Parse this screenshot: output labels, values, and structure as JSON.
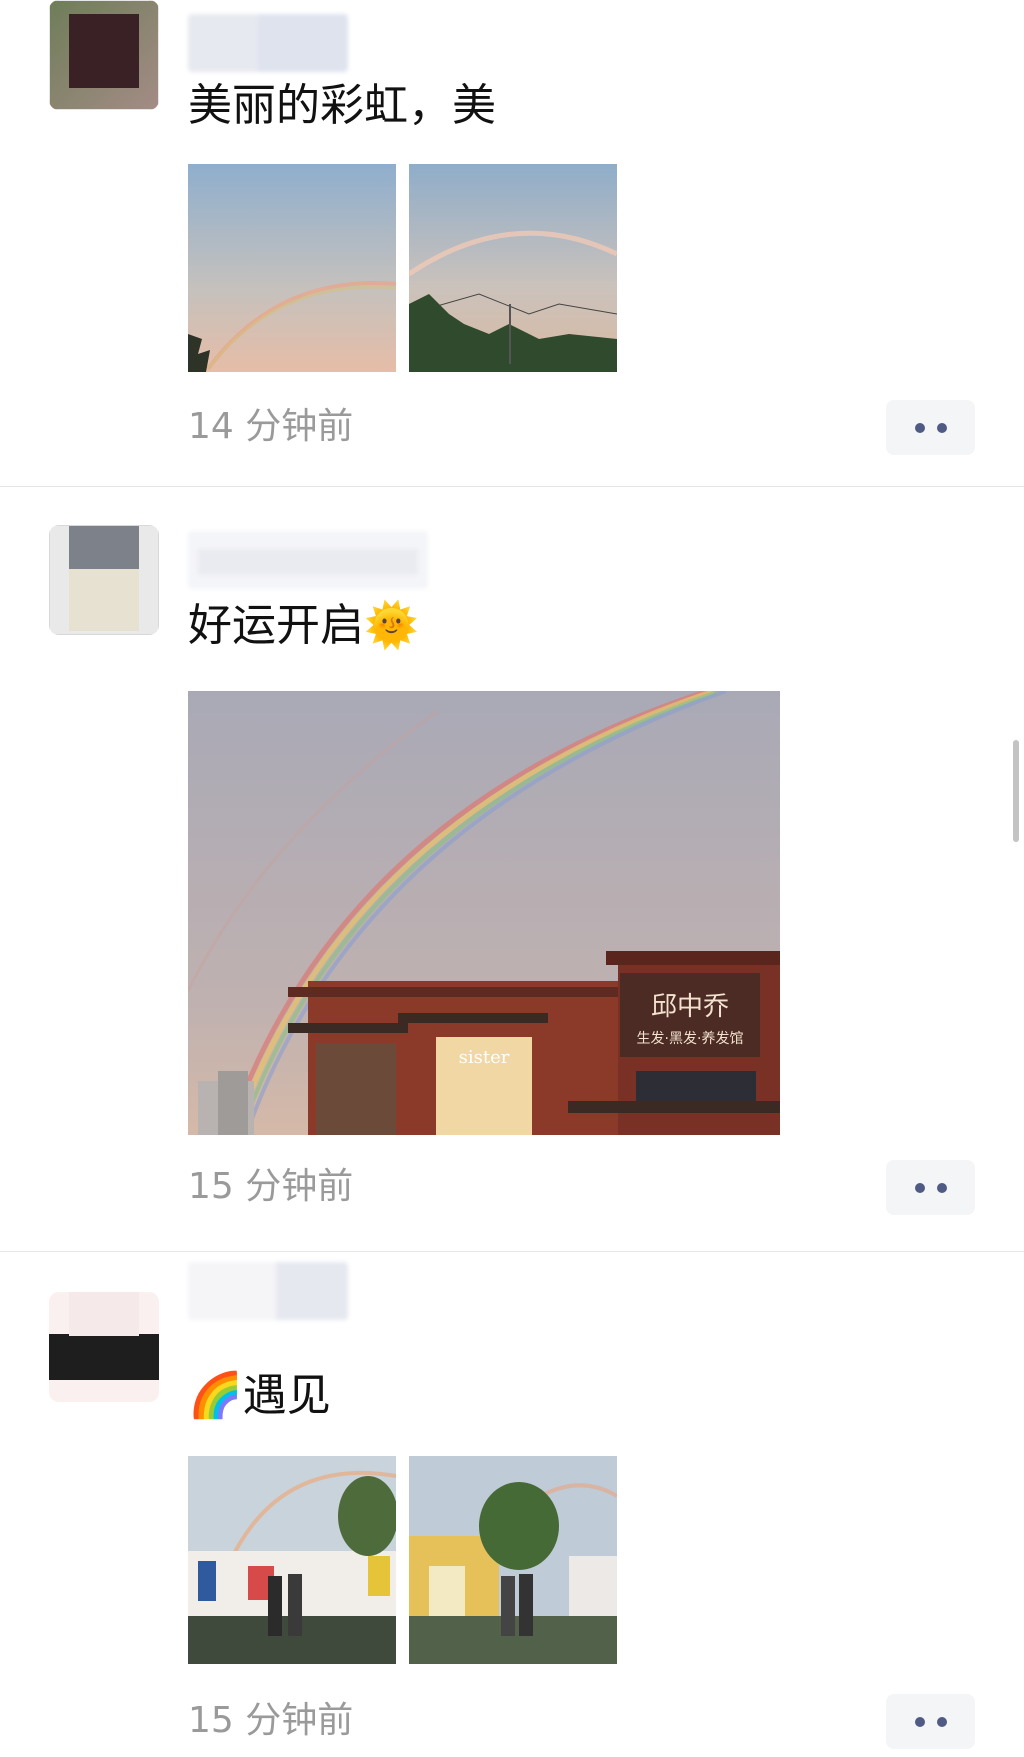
{
  "posts": [
    {
      "text": "美丽的彩虹，美",
      "time": "14 分钟前"
    },
    {
      "text": "好运开启",
      "emoji": "🌞",
      "time": "15 分钟前"
    },
    {
      "emoji": "🌈",
      "text": "遇见",
      "time": "15 分钟前"
    }
  ],
  "shop_sign": {
    "title": "邱中乔",
    "subtitle": "生发·黑发·养发馆",
    "store": "sister"
  },
  "colors": {
    "accent": "#4f5b83",
    "timestamp": "#9a9a9a",
    "button_bg": "#f4f5f7",
    "divider": "#e6e6e6"
  },
  "icons": [
    "more-icon",
    "sun-emoji",
    "rainbow-emoji"
  ]
}
